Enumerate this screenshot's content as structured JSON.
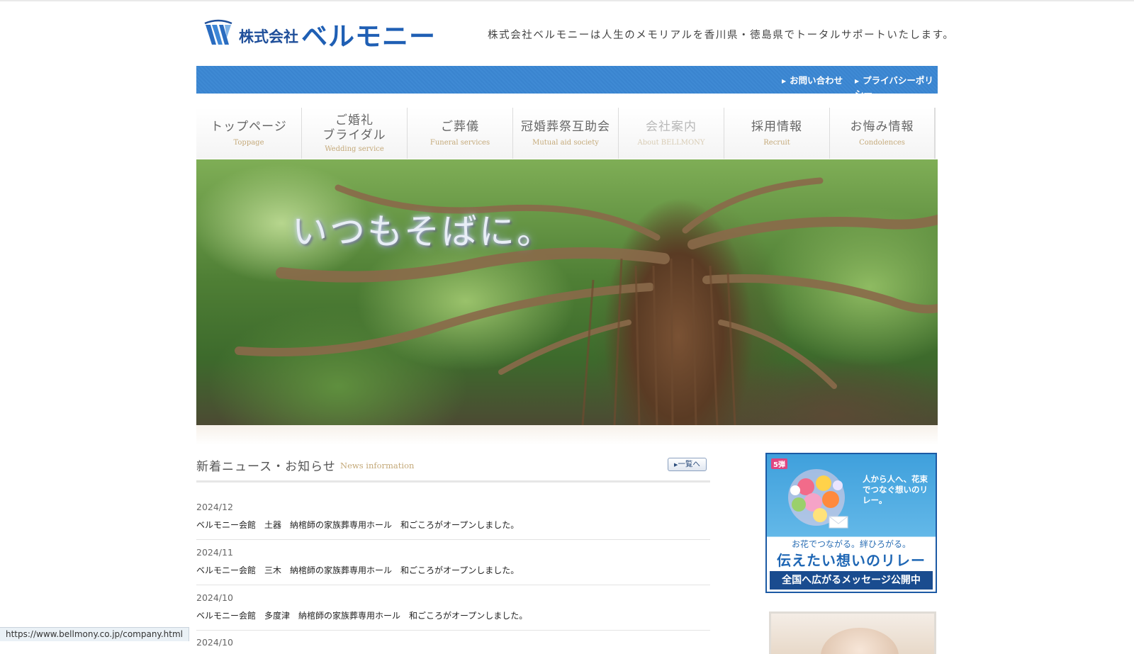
{
  "header": {
    "logo_company": "株式会社",
    "logo_name": "ベルモニー",
    "tagline": "株式会社ベルモニーは人生のメモリアルを香川県・徳島県でトータルサポートいたします。"
  },
  "utility_links": [
    {
      "label": "お問い合わせ"
    },
    {
      "label": "プライバシーポリシー"
    }
  ],
  "nav": [
    {
      "jp": "トップページ",
      "en": "Toppage"
    },
    {
      "jp": "ご婚礼\nブライダル",
      "en": "Wedding service"
    },
    {
      "jp": "ご葬儀",
      "en": "Funeral services"
    },
    {
      "jp": "冠婚葬祭互助会",
      "en": "Mutual aid society"
    },
    {
      "jp": "会社案内",
      "en": "About BELLMONY",
      "active": true
    },
    {
      "jp": "採用情報",
      "en": "Recruit"
    },
    {
      "jp": "お悔み情報",
      "en": "Condolences"
    }
  ],
  "hero": {
    "text": "いつもそばに。"
  },
  "news": {
    "title": "新着ニュース・お知らせ",
    "subtitle": "News information",
    "list_button": "一覧へ",
    "items": [
      {
        "date": "2024/12",
        "text": "ベルモニー会館　土器　納棺師の家族葬専用ホール　和ごころがオープンしました。"
      },
      {
        "date": "2024/11",
        "text": "ベルモニー会館　三木　納棺師の家族葬専用ホール　和ごころがオープンしました。"
      },
      {
        "date": "2024/10",
        "text": "ベルモニー会館　多度津　納棺師の家族葬専用ホール　和ごころがオープンしました。"
      },
      {
        "date": "2024/10",
        "text": ""
      }
    ]
  },
  "banner1": {
    "badge": "5弾",
    "copy": "人から人へ、花束でつなぐ想いのリレー。",
    "line1": "お花でつながる。絆ひろがる。",
    "line2": "伝えたい想いのリレー",
    "bar": "全国へ広がるメッセージ公開中"
  },
  "status_url": "https://www.bellmony.co.jp/company.html",
  "colors": {
    "brand_blue": "#1f5fb4",
    "bar_blue": "#3a84cf",
    "gold": "#c4a979"
  }
}
